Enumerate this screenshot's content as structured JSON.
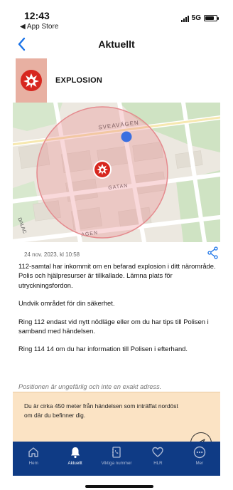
{
  "status_bar": {
    "time": "12:43",
    "back_app": "◀ App Store",
    "network": "5G",
    "icons": [
      "signal-icon",
      "battery-icon"
    ]
  },
  "nav": {
    "title": "Aktuellt",
    "back_icon": "chevron-left-icon"
  },
  "event": {
    "title": "EXPLOSION",
    "icon": "explosion-icon",
    "accent_color": "#d7261e",
    "icon_bg_color": "#e8b0a2"
  },
  "map": {
    "street_labels": [
      "SVEAVÄGEN",
      "GATAN",
      "AGEN",
      "DALAC"
    ],
    "user_location_color": "#3b6fe0",
    "alert_radius_color": "#e8757c"
  },
  "details": {
    "timestamp": "24 nov. 2023, kl 10:58",
    "share_icon": "share-icon",
    "paragraphs": [
      "112-samtal har inkommit om en befarad explosion i ditt närområde. Polis och hjälpresurser är tillkallade. Lämna plats för utryckningsfordon.",
      "Undvik området för din säkerhet.",
      "Ring 112 endast vid nytt nödläge eller om du har tips till Polisen i samband med händelsen.",
      "Ring 114 14 om du har information till Polisen i efterhand."
    ],
    "disclaimer": "Positionen är ungefärlig och inte en exakt adress."
  },
  "distance_panel": {
    "text": "Du är cirka 450 meter från händelsen som inträffat nordöst om där du befinner dig.",
    "bg_color": "#fbe3c4"
  },
  "tab_bar": {
    "bg_color": "#0f3b85",
    "tabs": [
      {
        "label": "Hem",
        "icon": "home-icon"
      },
      {
        "label": "Aktuellt",
        "icon": "bell-icon",
        "active": true
      },
      {
        "label": "Viktiga nummer",
        "icon": "phone-book-icon"
      },
      {
        "label": "HLR",
        "icon": "heart-icon"
      },
      {
        "label": "Mer",
        "icon": "more-icon"
      }
    ]
  }
}
